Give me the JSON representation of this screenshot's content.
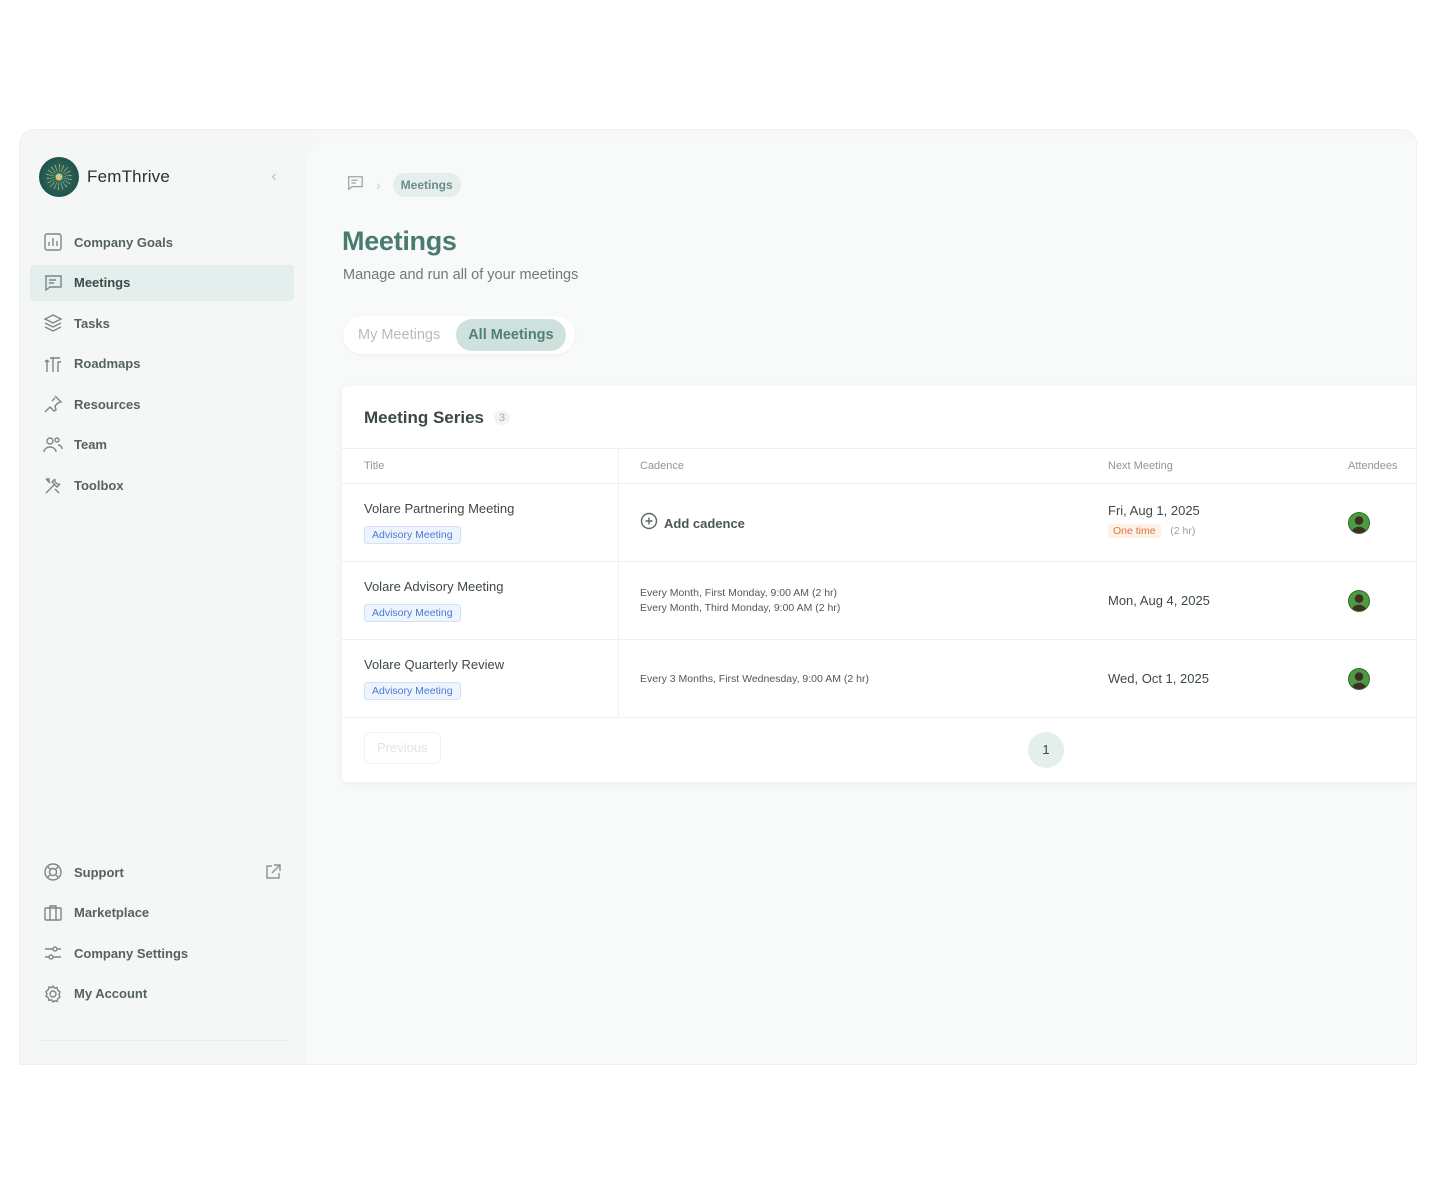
{
  "brand": {
    "name": "FemThrive"
  },
  "sidebar": {
    "items": [
      {
        "label": "Company Goals",
        "icon": "chart-icon"
      },
      {
        "label": "Meetings",
        "icon": "message-square-icon",
        "active": true
      },
      {
        "label": "Tasks",
        "icon": "layers-icon"
      },
      {
        "label": "Roadmaps",
        "icon": "roadmap-icon"
      },
      {
        "label": "Resources",
        "icon": "pin-icon"
      },
      {
        "label": "Team",
        "icon": "users-icon"
      },
      {
        "label": "Toolbox",
        "icon": "tools-icon"
      }
    ],
    "bottom_items": [
      {
        "label": "Support",
        "icon": "lifebuoy-icon"
      },
      {
        "label": "Marketplace",
        "icon": "store-icon"
      },
      {
        "label": "Company Settings",
        "icon": "sliders-icon"
      },
      {
        "label": "My Account",
        "icon": "gear-icon"
      }
    ]
  },
  "breadcrumb": {
    "current": "Meetings"
  },
  "page": {
    "title": "Meetings",
    "subtitle": "Manage and run all of your meetings"
  },
  "tabs": [
    {
      "label": "My Meetings",
      "active": false
    },
    {
      "label": "All Meetings",
      "active": true
    }
  ],
  "series": {
    "title": "Meeting Series",
    "count": "3",
    "columns": {
      "title": "Title",
      "cadence": "Cadence",
      "next": "Next Meeting",
      "attendees": "Attendees"
    },
    "add_cadence_label": "Add cadence",
    "rows": [
      {
        "title": "Volare Partnering Meeting",
        "tag": "Advisory Meeting",
        "cadence": [],
        "next": "Fri, Aug 1, 2025",
        "badge": "One time",
        "duration": "(2 hr)"
      },
      {
        "title": "Volare Advisory Meeting",
        "tag": "Advisory Meeting",
        "cadence": [
          "Every Month, First Monday, 9:00 AM (2 hr)",
          "Every Month, Third Monday, 9:00 AM (2 hr)"
        ],
        "next": "Mon, Aug 4, 2025"
      },
      {
        "title": "Volare Quarterly Review",
        "tag": "Advisory Meeting",
        "cadence": [
          "Every 3 Months, First Wednesday, 9:00 AM (2 hr)"
        ],
        "next": "Wed, Oct 1, 2025"
      }
    ]
  },
  "pagination": {
    "previous_label": "Previous",
    "current_page": "1"
  },
  "colors": {
    "accent": "#4a7a70",
    "active_bg": "#e4eeec",
    "tag_blue": "#4a7bd0",
    "badge_orange": "#d9773a"
  }
}
